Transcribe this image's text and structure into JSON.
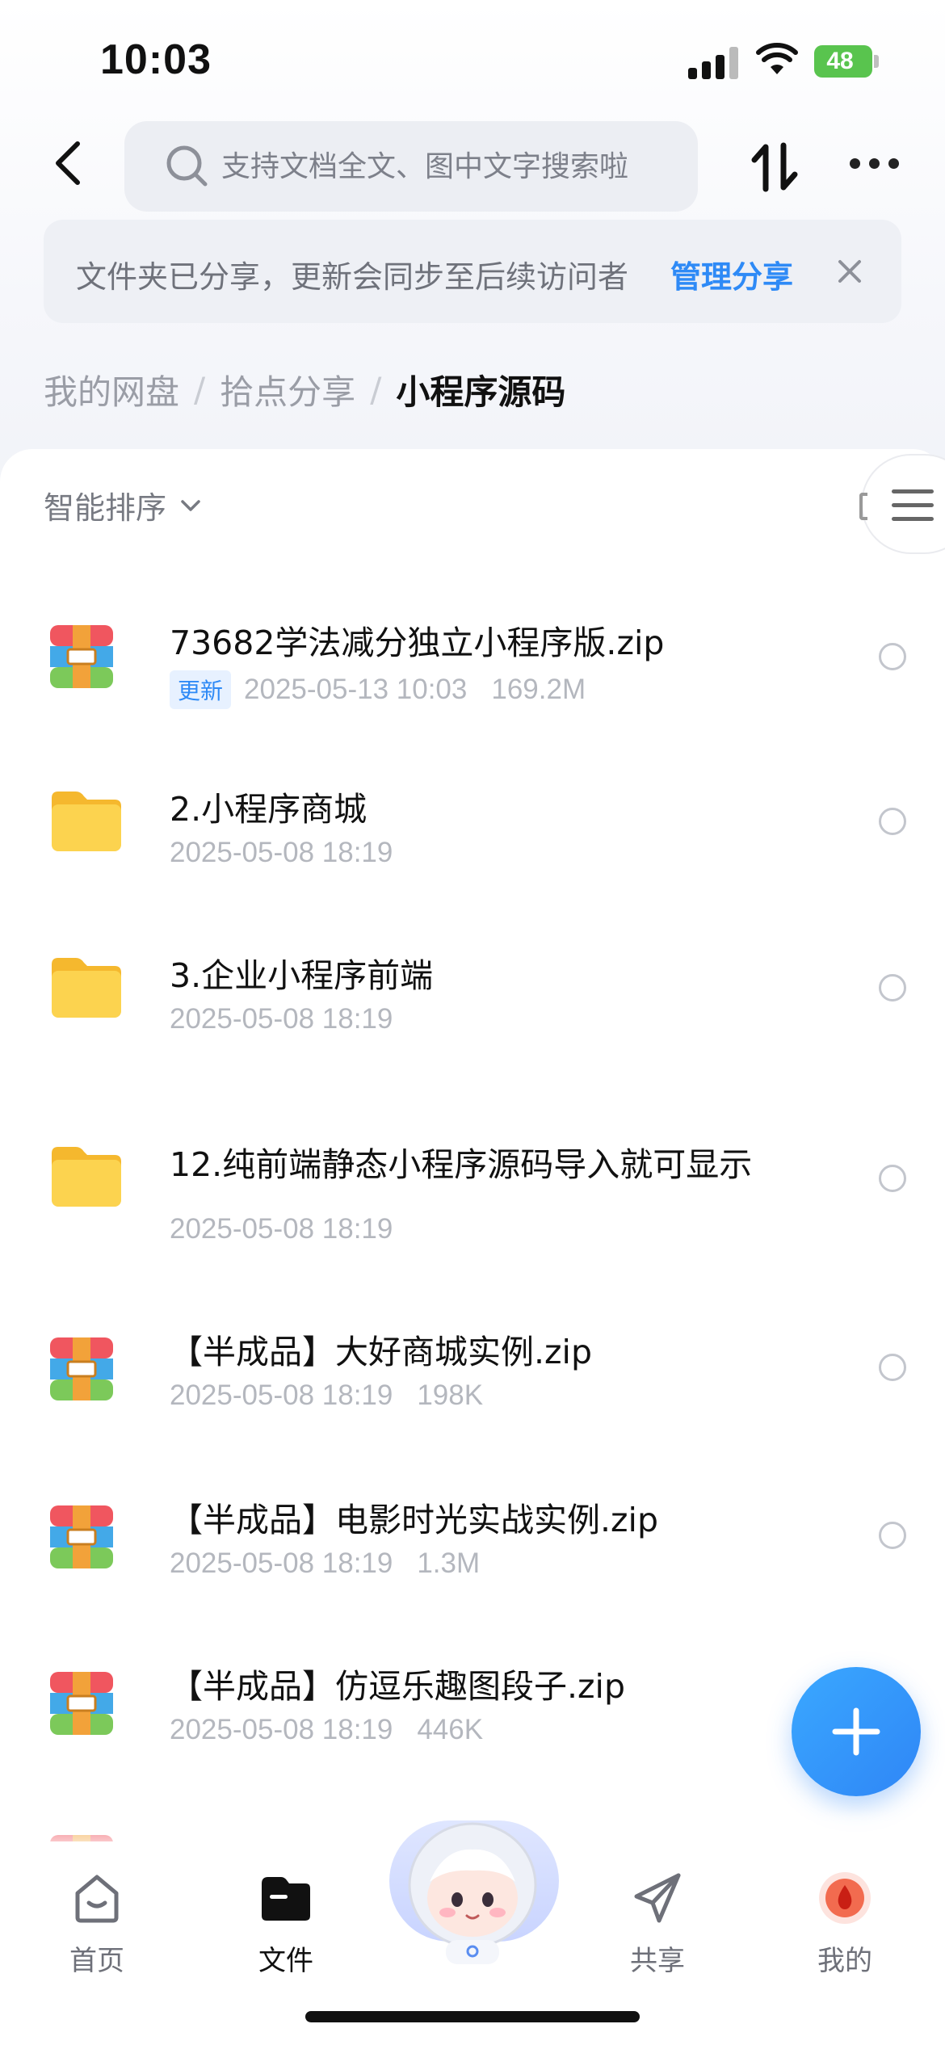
{
  "status_bar": {
    "time": "10:03",
    "battery": "48"
  },
  "header": {
    "search_placeholder": "支持文档全文、图中文字搜索啦"
  },
  "share_banner": {
    "text": "文件夹已分享，更新会同步至后续访问者",
    "action": "管理分享"
  },
  "breadcrumb": [
    "我的网盘",
    "拾点分享",
    "小程序源码"
  ],
  "sort_label": "智能排序",
  "files": [
    {
      "type": "zip",
      "name": "73682学法减分独立小程序版.zip",
      "badge": "更新",
      "date": "2025-05-13 10:03",
      "size": "169.2M"
    },
    {
      "type": "folder",
      "name": "2.小程序商城",
      "date": "2025-05-08 18:19"
    },
    {
      "type": "folder",
      "name": "3.企业小程序前端",
      "date": "2025-05-08 18:19"
    },
    {
      "type": "folder",
      "name": "12.纯前端静态小程序源码导入就可显示",
      "date": "2025-05-08 18:19"
    },
    {
      "type": "zip",
      "name": "【半成品】大好商城实例.zip",
      "date": "2025-05-08 18:19",
      "size": "198K"
    },
    {
      "type": "zip",
      "name": "【半成品】电影时光实战实例.zip",
      "date": "2025-05-08 18:19",
      "size": "1.3M"
    },
    {
      "type": "zip",
      "name": "【半成品】仿逗乐趣图段子.zip",
      "date": "2025-05-08 18:19",
      "size": "446K"
    }
  ],
  "tabs": [
    {
      "label": "首页",
      "icon": "home-icon"
    },
    {
      "label": "文件",
      "icon": "folder-icon",
      "active": true
    },
    {
      "label": "",
      "icon": "mascot-icon"
    },
    {
      "label": "共享",
      "icon": "paper-plane-icon"
    },
    {
      "label": "我的",
      "icon": "profile-drop-icon"
    }
  ],
  "colors": {
    "accent": "#2e8af6",
    "fab": "#2f86f6"
  }
}
